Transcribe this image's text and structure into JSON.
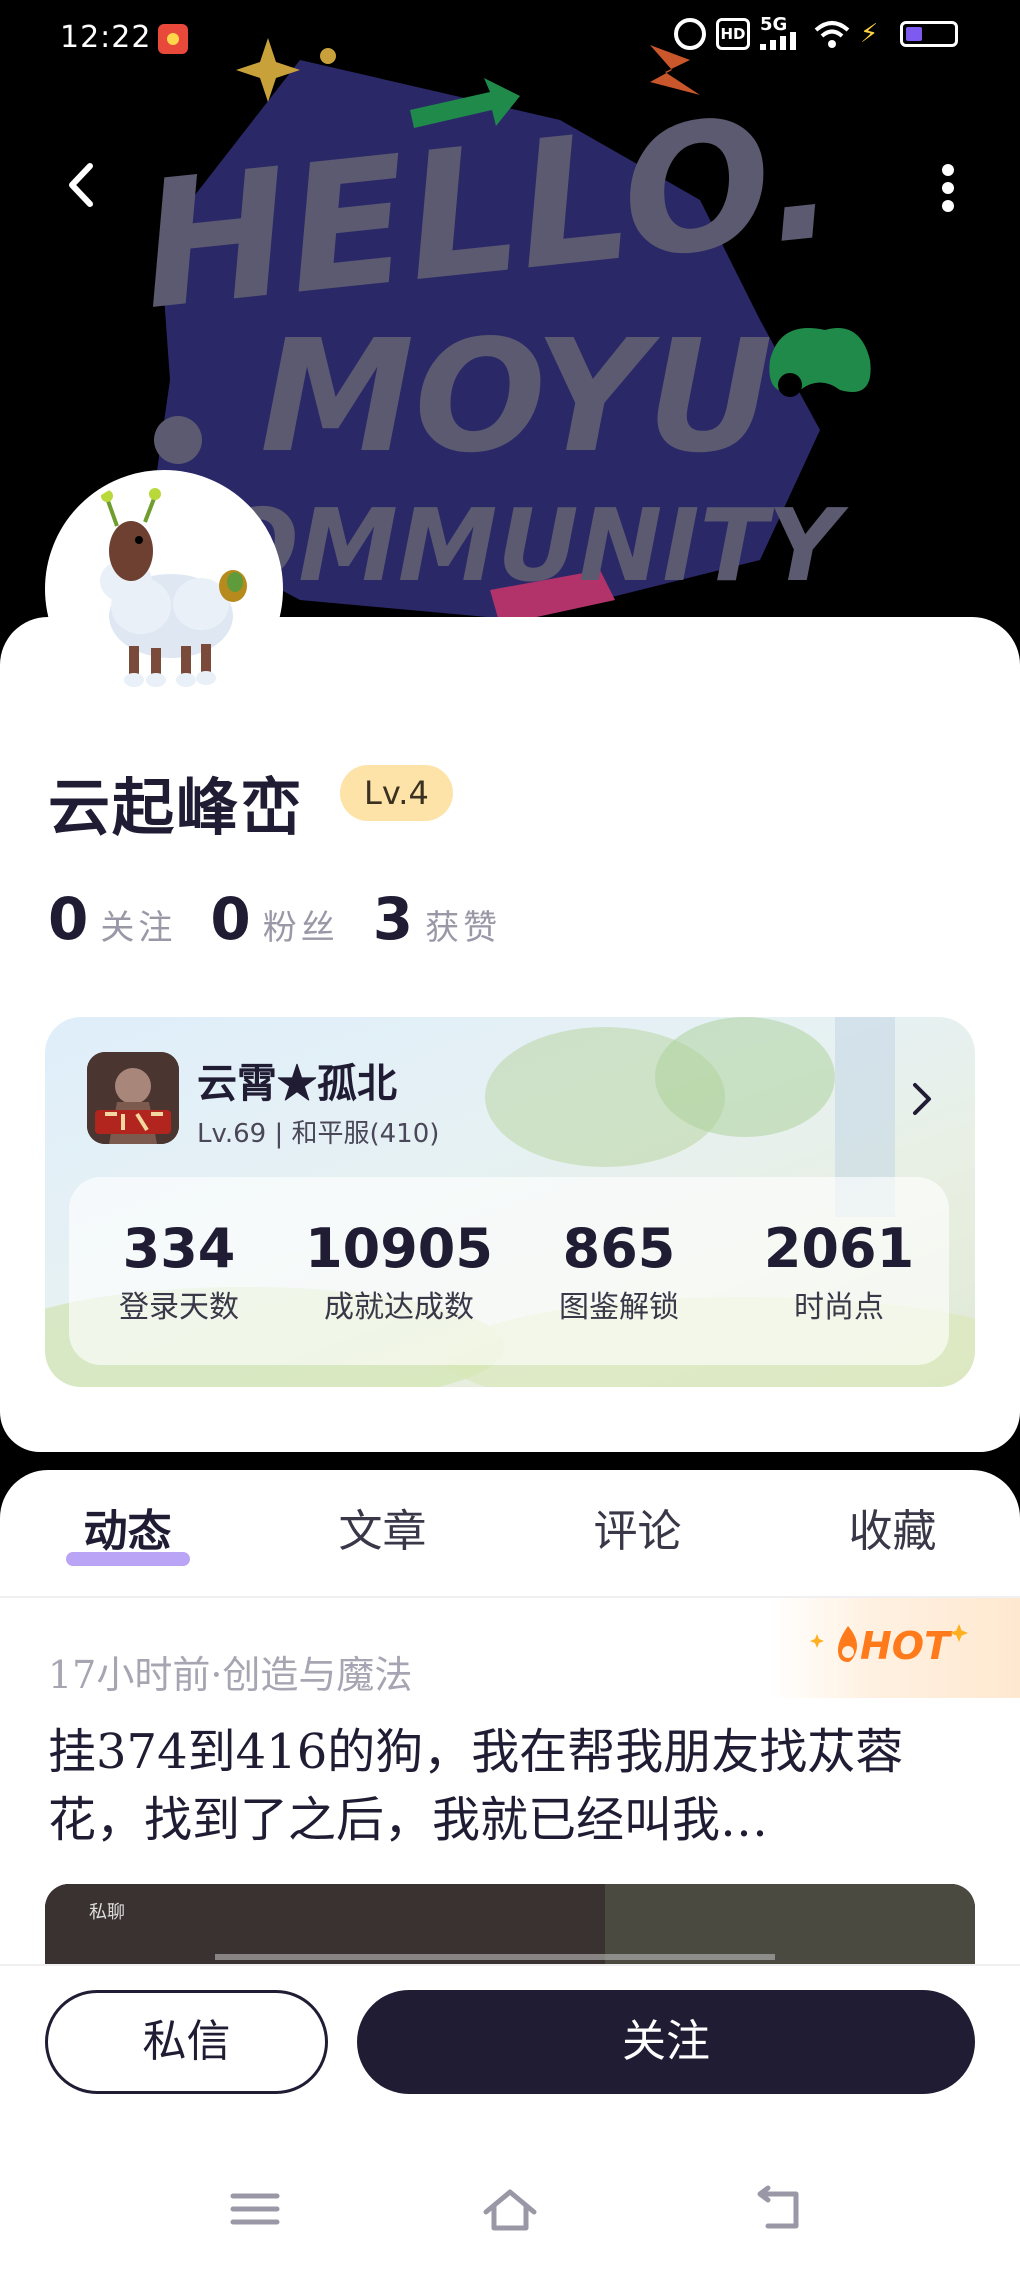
{
  "status_bar": {
    "time": "12:22",
    "hd_label": "HD",
    "network_label": "5G"
  },
  "banner": {
    "art_text_line1": "HELLO.",
    "art_text_line2": "MOYU",
    "art_text_line3": "COMMUNITY"
  },
  "profile": {
    "username": "云起峰峦",
    "level": "Lv.4",
    "stats": [
      {
        "value": "0",
        "label": "关注"
      },
      {
        "value": "0",
        "label": "粉丝"
      },
      {
        "value": "3",
        "label": "获赞"
      }
    ]
  },
  "game_card": {
    "game_name": "云霄★孤北",
    "meta": "Lv.69 | 和平服(410)",
    "stats": [
      {
        "value": "334",
        "label": "登录天数"
      },
      {
        "value": "10905",
        "label": "成就达成数"
      },
      {
        "value": "865",
        "label": "图鉴解锁"
      },
      {
        "value": "2061",
        "label": "时尚点"
      }
    ]
  },
  "tabs": [
    {
      "label": "动态",
      "active": true
    },
    {
      "label": "文章",
      "active": false
    },
    {
      "label": "评论",
      "active": false
    },
    {
      "label": "收藏",
      "active": false
    }
  ],
  "post": {
    "meta": "17小时前·创造与魔法",
    "hot_label": "HOT",
    "text": "挂374到416的狗，我在帮我朋友找苁蓉花，找到了之后，我就已经叫我…",
    "image_label": "私聊"
  },
  "actions": {
    "message_label": "私信",
    "follow_label": "关注"
  },
  "colors": {
    "primary": "#1f1c33",
    "level_badge": "#fde3a7",
    "tab_indicator": "#b9a4f5",
    "hot": "#ff7a1a"
  }
}
